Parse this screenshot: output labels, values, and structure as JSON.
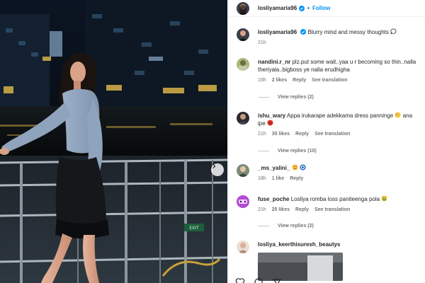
{
  "post": {
    "username": "losliyamaria96",
    "follow_label": "Follow",
    "dot": "•",
    "caption": "Blurry mind and messy thoughts",
    "caption_time": "21h"
  },
  "comments": [
    {
      "user": "nandini.r_nr",
      "text": "plz.put some wait..yaa u r becoming so thin..nalla theriyala..bigboss ye nalla erudhigha",
      "time": "15h",
      "likes": "2 likes",
      "reply": "Reply",
      "translate": "See translation",
      "view_replies": "View replies (2)"
    },
    {
      "user": "ishu_wary",
      "text": "Appa irukarape adekkama dress panninge",
      "text_after": "ana ipe",
      "time": "21h",
      "likes": "30 likes",
      "reply": "Reply",
      "translate": "See translation",
      "view_replies": "View replies (10)"
    },
    {
      "user": "_ms_yalini_",
      "text": "",
      "time": "18h",
      "likes": "1 like",
      "reply": "Reply"
    },
    {
      "user": "fuse_poche",
      "text": "Losliya romba loss paniteenga pola",
      "time": "21h",
      "likes": "25 likes",
      "reply": "Reply",
      "translate": "See translation",
      "view_replies": "View replies (2)"
    },
    {
      "user": "losliya_keerthisuresh_beautys",
      "text": ""
    }
  ],
  "media_sign": "EXIT",
  "colors": {
    "link": "#0095f6",
    "text": "#262626",
    "muted": "#737373",
    "verified": "#0095f6"
  },
  "icons": [
    "verified-icon",
    "chat-bubble-icon",
    "next-arrow-icon",
    "heart-icon",
    "comment-icon",
    "share-icon"
  ]
}
